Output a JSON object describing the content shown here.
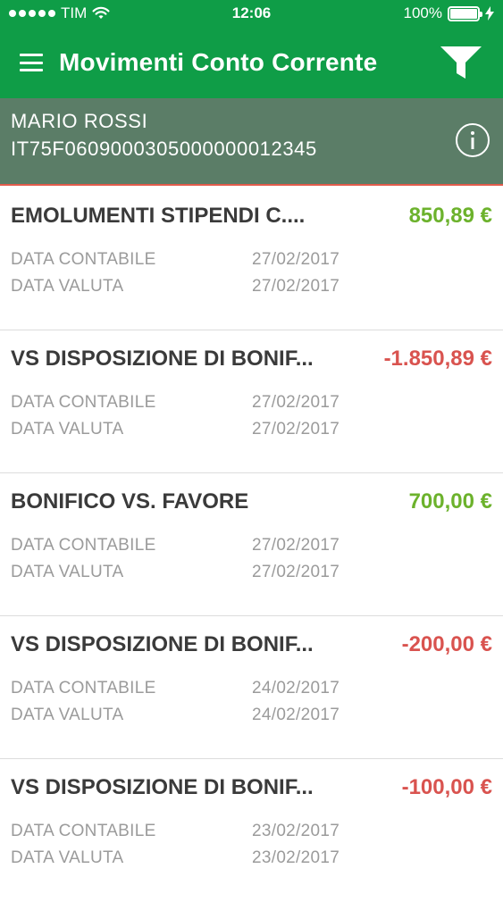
{
  "status_bar": {
    "carrier": "TIM",
    "time": "12:06",
    "battery": "100%"
  },
  "header": {
    "title": "Movimenti Conto Corrente"
  },
  "account": {
    "name": "MARIO ROSSI",
    "iban": "IT75F0609000305000000012345"
  },
  "labels": {
    "data_contabile": "DATA CONTABILE",
    "data_valuta": "DATA VALUTA"
  },
  "movements": [
    {
      "description": "EMOLUMENTI STIPENDI C....",
      "amount": "850,89 €",
      "sign": "positive",
      "data_contabile": "27/02/2017",
      "data_valuta": "27/02/2017"
    },
    {
      "description": "VS DISPOSIZIONE DI BONIF...",
      "amount": "-1.850,89 €",
      "sign": "negative",
      "data_contabile": "27/02/2017",
      "data_valuta": "27/02/2017"
    },
    {
      "description": "BONIFICO VS. FAVORE",
      "amount": "700,00 €",
      "sign": "positive",
      "data_contabile": "27/02/2017",
      "data_valuta": "27/02/2017"
    },
    {
      "description": "VS DISPOSIZIONE DI BONIF...",
      "amount": "-200,00 €",
      "sign": "negative",
      "data_contabile": "24/02/2017",
      "data_valuta": "24/02/2017"
    },
    {
      "description": "VS DISPOSIZIONE DI BONIF...",
      "amount": "-100,00 €",
      "sign": "negative",
      "data_contabile": "23/02/2017",
      "data_valuta": "23/02/2017"
    }
  ],
  "colors": {
    "brand_green": "#0f9d47",
    "banner_green": "#5b7d67",
    "positive": "#6cb22c",
    "negative": "#d9534f"
  },
  "icons": {
    "menu": "hamburger-icon",
    "filter": "filter-funnel-icon",
    "info": "info-circle-icon",
    "wifi": "wifi-icon",
    "signal": "signal-dots-icon",
    "battery": "battery-icon",
    "charging": "charging-bolt-icon"
  }
}
